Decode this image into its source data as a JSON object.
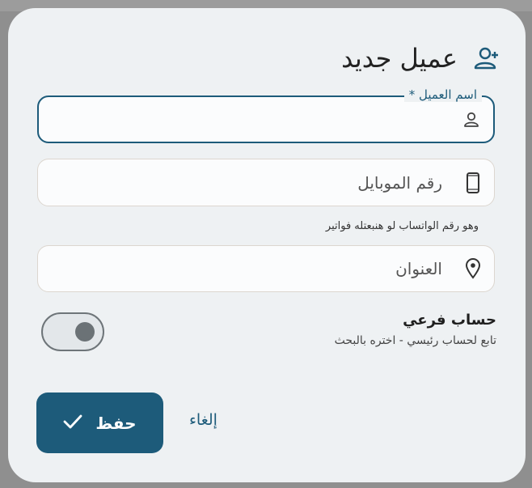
{
  "dialog": {
    "title": "عميل جديد",
    "title_icon": "add-person-icon",
    "fields": {
      "name": {
        "label": "اسم العميل *",
        "value": "",
        "icon": "person-icon"
      },
      "mobile": {
        "placeholder": "رقم الموبايل",
        "icon": "phone-icon",
        "helper": "وهو رقم الواتساب لو هنبعتله فواتير"
      },
      "address": {
        "placeholder": "العنوان",
        "icon": "location-pin-icon"
      }
    },
    "sub_account": {
      "title": "حساب فرعي",
      "description": "تابع لحساب رئيسي - اختره بالبحث",
      "enabled": false
    },
    "actions": {
      "save_label": "حفظ",
      "cancel_label": "إلغاء"
    }
  },
  "colors": {
    "primary": "#1d5b7a",
    "dialog_bg": "#eef1f3",
    "overlay": "#8f8f8f"
  }
}
